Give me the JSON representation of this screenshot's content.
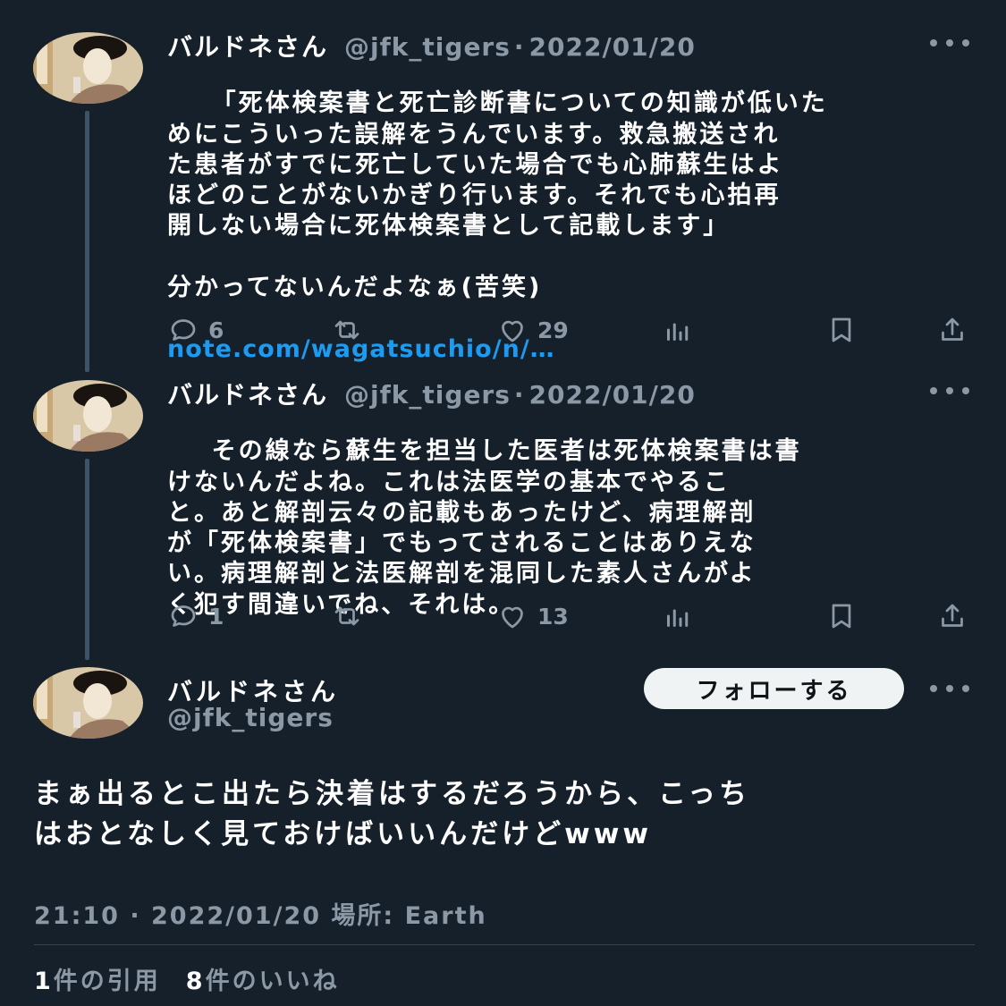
{
  "replies": [
    {
      "user_name": "バルドネさん",
      "handle": "@jfk_tigers",
      "separator": "·",
      "date": "2022/01/20",
      "text": "「死体検案書と死亡診断書についての知識が低いた\nめにこういった誤解をうんでいます。救急搬送され\nた患者がすでに死亡していた場合でも心肺蘇生はよ\nほどのことがないかぎり行います。それでも心拍再\n開しない場合に死体検案書として記載します」\n\n分かってないんだよなぁ(苦笑)",
      "link": "note.com/wagatsuchio/n/…",
      "reply_count": "6",
      "retweet_count": "",
      "like_count": "29"
    },
    {
      "user_name": "バルドネさん",
      "handle": "@jfk_tigers",
      "separator": "·",
      "date": "2022/01/20",
      "text": "その線なら蘇生を担当した医者は死体検案書は書\nけないんだよね。これは法医学の基本でやるこ\nと。あと解剖云々の記載もあったけど、病理解剖\nが「死体検案書」でもってされることはありえな\nい。病理解剖と法医解剖を混同した素人さんがよ\nく犯す間違いでね、それは。",
      "link": "",
      "reply_count": "1",
      "retweet_count": "",
      "like_count": "13"
    }
  ],
  "main_tweet": {
    "user_name": "バルドネさん",
    "handle": "@jfk_tigers",
    "follow_label": "フォローする",
    "text": "まぁ出るとこ出たら決着はするだろうから、こっち\nはおとなしく見ておけばいいんだけどwww",
    "meta": "21:10 · 2022/01/20 場所: Earth",
    "quote_count": "1",
    "quote_label": "件の引用",
    "like_count": "8",
    "like_label": "件のいいね"
  },
  "icons": {
    "reply": "reply-icon",
    "retweet": "retweet-icon",
    "like": "heart-icon",
    "views": "analytics-icon",
    "bookmark": "bookmark-icon",
    "share": "share-icon",
    "more": "more-icon"
  },
  "colors": {
    "background": "#15202b",
    "text": "#ffffff",
    "secondary": "#8b98a5",
    "link": "#1d9bf0",
    "thread_line": "#3d5466",
    "follow_bg": "#eff3f4"
  }
}
